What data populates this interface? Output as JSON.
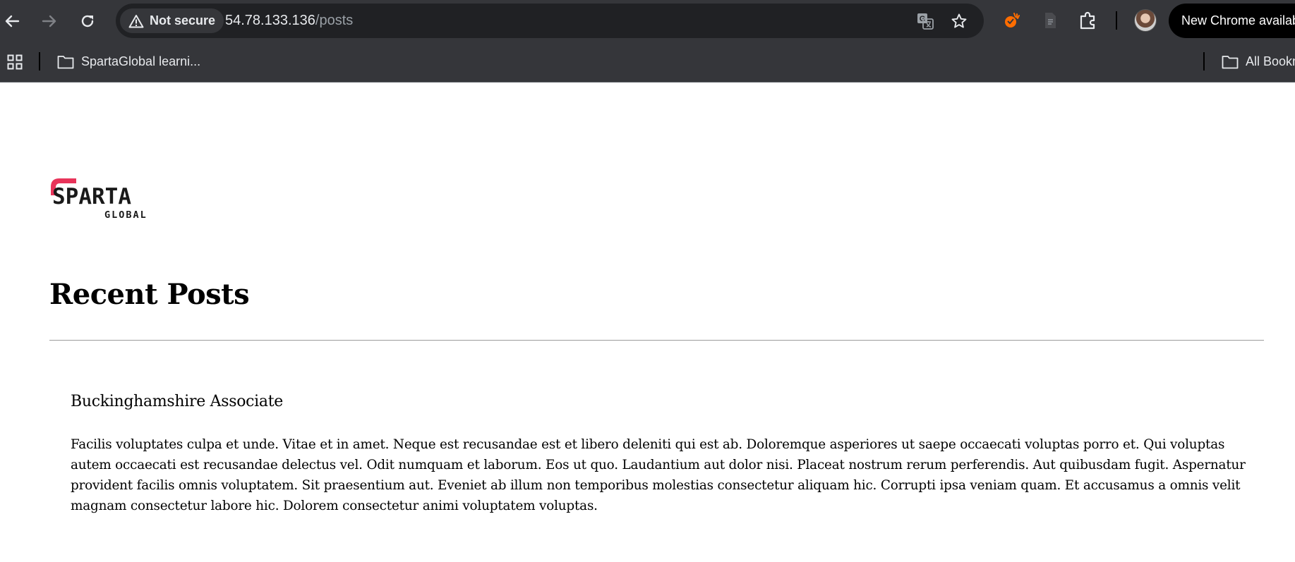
{
  "browser": {
    "security_label": "Not secure",
    "url_host": "54.78.133.136",
    "url_path": "/posts",
    "update_button_label": "New Chrome available",
    "bookmarks": {
      "folder_label": "SpartaGlobal learni...",
      "all_bookmarks_label": "All Bookmarks"
    },
    "icons": {
      "back": "back-arrow-icon",
      "forward": "forward-arrow-icon",
      "reload": "reload-icon",
      "warning": "warning-triangle-icon",
      "translate": "translate-icon",
      "star": "star-icon",
      "extension_orange": "orange-extension-icon",
      "extension_doc": "document-extension-icon",
      "extensions": "puzzle-icon",
      "apps": "apps-grid-icon",
      "folder": "folder-icon"
    },
    "colors": {
      "chrome_bg": "#35363a",
      "omnibox_bg": "#202124",
      "extension_accent": "#ff6d00"
    }
  },
  "page": {
    "logo": {
      "text_main": "SPARTA",
      "text_sub": "GLOBAL",
      "accent_color": "#e8345a"
    },
    "heading": "Recent Posts",
    "posts": [
      {
        "title": "Buckinghamshire Associate",
        "body": "Facilis voluptates culpa et unde. Vitae et in amet. Neque est recusandae est et libero deleniti qui est ab. Doloremque asperiores ut saepe occaecati voluptas porro et. Qui voluptas autem occaecati est recusandae delectus vel. Odit numquam et laborum. Eos ut quo. Laudantium aut dolor nisi. Placeat nostrum rerum perferendis. Aut quibusdam fugit. Aspernatur provident facilis omnis voluptatem. Sit praesentium aut. Eveniet ab illum non temporibus molestias consectetur aliquam hic. Corrupti ipsa veniam quam. Et accusamus a omnis velit magnam consectetur labore hic. Dolorem consectetur animi voluptatem voluptas."
      }
    ]
  }
}
